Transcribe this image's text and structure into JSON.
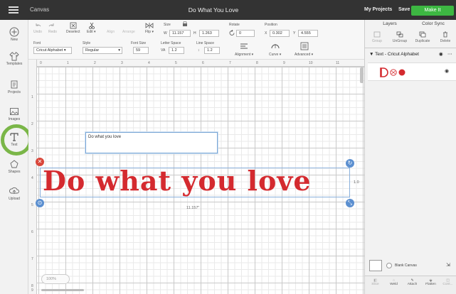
{
  "topbar": {
    "app": "Canvas",
    "title": "Do What You Love",
    "my_projects": "My Projects",
    "save": "Save",
    "make_it": "Make It"
  },
  "leftbar": {
    "new": "New",
    "templates": "Templates",
    "projects": "Projects",
    "images": "Images",
    "text": "Text",
    "shapes": "Shapes",
    "upload": "Upload"
  },
  "editbar": {
    "undo": "Undo",
    "redo": "Redo",
    "deselect": "Deselect",
    "edit": "Edit",
    "align": "Align",
    "arrange": "Arrange",
    "flip": "Flip",
    "size_label": "Size",
    "w_label": "W",
    "w_value": "11.157",
    "h_label": "H",
    "h_value": "1.263",
    "rotate_label": "Rotate",
    "rotate_value": "0",
    "position_label": "Position",
    "x_label": "X",
    "x_value": "0.302",
    "y_label": "Y",
    "y_value": "4.555",
    "font_label": "Font",
    "font_value": "Cricut Alphabet",
    "style_label": "Style",
    "style_value": "Regular",
    "font_size_label": "Font Size",
    "font_size_value": "59",
    "letter_space_label": "Letter Space",
    "letter_space_value": "1.2",
    "line_space_label": "Line Space",
    "line_space_value": "1.2",
    "alignment": "Alignment",
    "curve": "Curve",
    "advanced": "Advanced"
  },
  "rulers": {
    "top": [
      "0",
      "1",
      "2",
      "3",
      "4",
      "5",
      "6",
      "7",
      "8",
      "9",
      "10",
      "11"
    ],
    "left": [
      "1",
      "2",
      "3",
      "4",
      "5",
      "6",
      "7",
      "8",
      "9"
    ]
  },
  "canvas": {
    "textbox_value": "Do what you love",
    "big_text": "Do what you love",
    "width_label": "11.157\"",
    "height_label": "1.0",
    "zoom": "100%"
  },
  "rightpanel": {
    "tab_layers": "Layers",
    "tab_color_sync": "Color Sync",
    "group": "Group",
    "ungroup": "UnGroup",
    "duplicate": "Duplicate",
    "delete": "Delete",
    "group_name": "Text - Cricut Alphabet",
    "blank_canvas": "Blank Canvas",
    "slice": "Slice",
    "weld": "Weld",
    "attach": "Attach",
    "flatten": "Flatten",
    "contour": "Cont..."
  },
  "colors": {
    "topbar": "#333333",
    "make_it": "#3db742",
    "text_red": "#d42a2f",
    "ring_green": "#7ab648"
  }
}
